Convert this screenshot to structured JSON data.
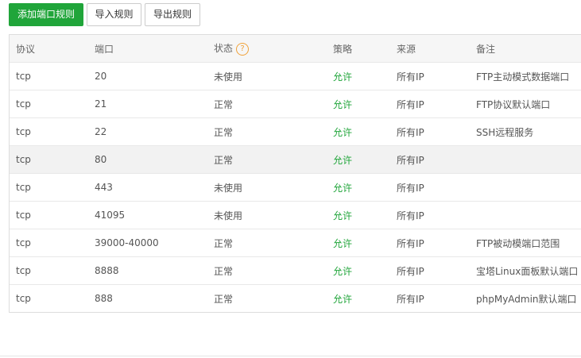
{
  "toolbar": {
    "add_label": "添加端口规则",
    "import_label": "导入规则",
    "export_label": "导出规则"
  },
  "table": {
    "headers": {
      "protocol": "协议",
      "port": "端口",
      "status": "状态",
      "status_help": "?",
      "policy": "策略",
      "source": "来源",
      "note": "备注"
    },
    "rows": [
      {
        "protocol": "tcp",
        "port": "20",
        "status": "未使用",
        "policy": "允许",
        "source": "所有IP",
        "note": "FTP主动模式数据端口"
      },
      {
        "protocol": "tcp",
        "port": "21",
        "status": "正常",
        "policy": "允许",
        "source": "所有IP",
        "note": "FTP协议默认端口"
      },
      {
        "protocol": "tcp",
        "port": "22",
        "status": "正常",
        "policy": "允许",
        "source": "所有IP",
        "note": "SSH远程服务"
      },
      {
        "protocol": "tcp",
        "port": "80",
        "status": "正常",
        "policy": "允许",
        "source": "所有IP",
        "note": ""
      },
      {
        "protocol": "tcp",
        "port": "443",
        "status": "未使用",
        "policy": "允许",
        "source": "所有IP",
        "note": ""
      },
      {
        "protocol": "tcp",
        "port": "41095",
        "status": "未使用",
        "policy": "允许",
        "source": "所有IP",
        "note": ""
      },
      {
        "protocol": "tcp",
        "port": "39000-40000",
        "status": "正常",
        "policy": "允许",
        "source": "所有IP",
        "note": "FTP被动模端口范围"
      },
      {
        "protocol": "tcp",
        "port": "8888",
        "status": "正常",
        "policy": "允许",
        "source": "所有IP",
        "note": "宝塔Linux面板默认端口"
      },
      {
        "protocol": "tcp",
        "port": "888",
        "status": "正常",
        "policy": "允许",
        "source": "所有IP",
        "note": "phpMyAdmin默认端口"
      }
    ]
  },
  "colors": {
    "primary": "#20a53a",
    "allow_text": "#20a53a",
    "help_icon": "#f0a23a"
  }
}
